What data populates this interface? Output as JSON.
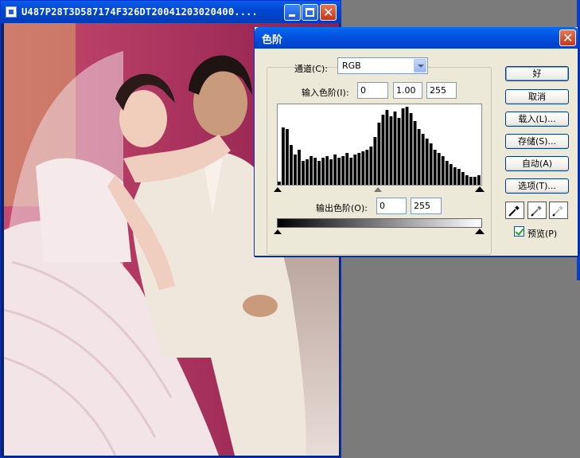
{
  "document": {
    "title": "U487P28T3D587174F326DT20041203020400...."
  },
  "levels": {
    "title": "色阶",
    "channel_label": "通道(C):",
    "channel_value": "RGB",
    "input_label": "输入色阶(I):",
    "input_black": "0",
    "input_gamma": "1.00",
    "input_white": "255",
    "output_label": "输出色阶(O):",
    "output_black": "0",
    "output_white": "255",
    "buttons": {
      "ok": "好",
      "cancel": "取消",
      "load": "载入(L)...",
      "save": "存储(S)...",
      "auto": "自动(A)",
      "options": "选项(T)..."
    },
    "preview_label": "预览(P)",
    "preview_checked": true,
    "histogram": [
      4,
      72,
      70,
      50,
      38,
      44,
      30,
      32,
      36,
      34,
      30,
      34,
      36,
      32,
      38,
      34,
      36,
      40,
      34,
      38,
      40,
      42,
      44,
      48,
      60,
      78,
      88,
      94,
      86,
      92,
      84,
      96,
      98,
      90,
      80,
      70,
      64,
      58,
      52,
      44,
      40,
      36,
      30,
      26,
      22,
      20,
      16,
      12,
      10,
      10,
      12
    ]
  }
}
